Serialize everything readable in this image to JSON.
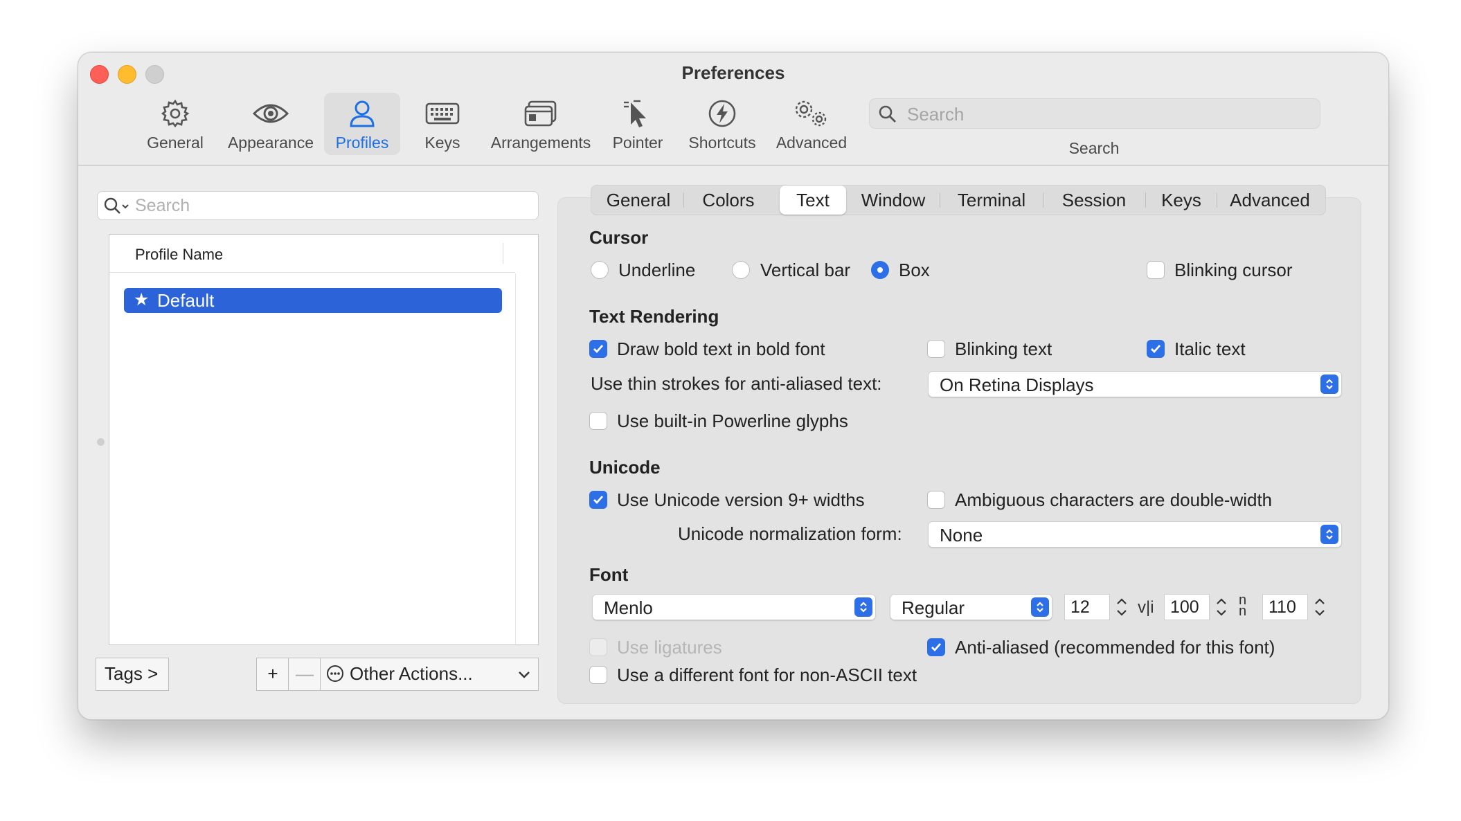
{
  "window": {
    "title": "Preferences"
  },
  "toolbar": {
    "items": [
      {
        "label": "General",
        "icon": "gear-icon"
      },
      {
        "label": "Appearance",
        "icon": "eye-icon"
      },
      {
        "label": "Profiles",
        "icon": "person-icon",
        "selected": true
      },
      {
        "label": "Keys",
        "icon": "keyboard-icon"
      },
      {
        "label": "Arrangements",
        "icon": "windows-icon"
      },
      {
        "label": "Pointer",
        "icon": "pointer-icon"
      },
      {
        "label": "Shortcuts",
        "icon": "bolt-icon"
      },
      {
        "label": "Advanced",
        "icon": "gears-icon"
      }
    ],
    "search_placeholder": "Search",
    "search_label": "Search"
  },
  "profiles": {
    "search_placeholder": "Search",
    "column_header": "Profile Name",
    "items": [
      {
        "name": "Default",
        "default": true,
        "selected": true
      }
    ],
    "tags_label": "Tags >",
    "add_label": "+",
    "remove_label": "—",
    "other_actions_label": "Other Actions..."
  },
  "tabs": {
    "items": [
      "General",
      "Colors",
      "Text",
      "Window",
      "Terminal",
      "Session",
      "Keys",
      "Advanced"
    ],
    "selected": "Text"
  },
  "cursor": {
    "title": "Cursor",
    "underline": "Underline",
    "vertical_bar": "Vertical bar",
    "box": "Box",
    "selected": "Box",
    "blinking": "Blinking cursor",
    "blinking_checked": false
  },
  "text_rendering": {
    "title": "Text Rendering",
    "bold": "Draw bold text in bold font",
    "bold_checked": true,
    "blinking_text": "Blinking text",
    "blinking_text_checked": false,
    "italic": "Italic text",
    "italic_checked": true,
    "thin_strokes_label": "Use thin strokes for anti-aliased text:",
    "thin_strokes_value": "On Retina Displays",
    "powerline": "Use built-in Powerline glyphs",
    "powerline_checked": false
  },
  "unicode": {
    "title": "Unicode",
    "widths": "Use Unicode version 9+ widths",
    "widths_checked": true,
    "ambiguous": "Ambiguous characters are double-width",
    "ambiguous_checked": false,
    "normalization_label": "Unicode normalization form:",
    "normalization_value": "None"
  },
  "font": {
    "title": "Font",
    "family": "Menlo",
    "weight": "Regular",
    "size": "12",
    "h_spacing": "100",
    "v_spacing": "110",
    "ligatures": "Use ligatures",
    "ligatures_enabled": false,
    "anti_aliased": "Anti-aliased (recommended for this font)",
    "anti_aliased_checked": true,
    "non_ascii": "Use a different font for non-ASCII text",
    "non_ascii_checked": false
  },
  "colors": {
    "accent": "#2d6fe6",
    "selection": "#2d63d9"
  }
}
